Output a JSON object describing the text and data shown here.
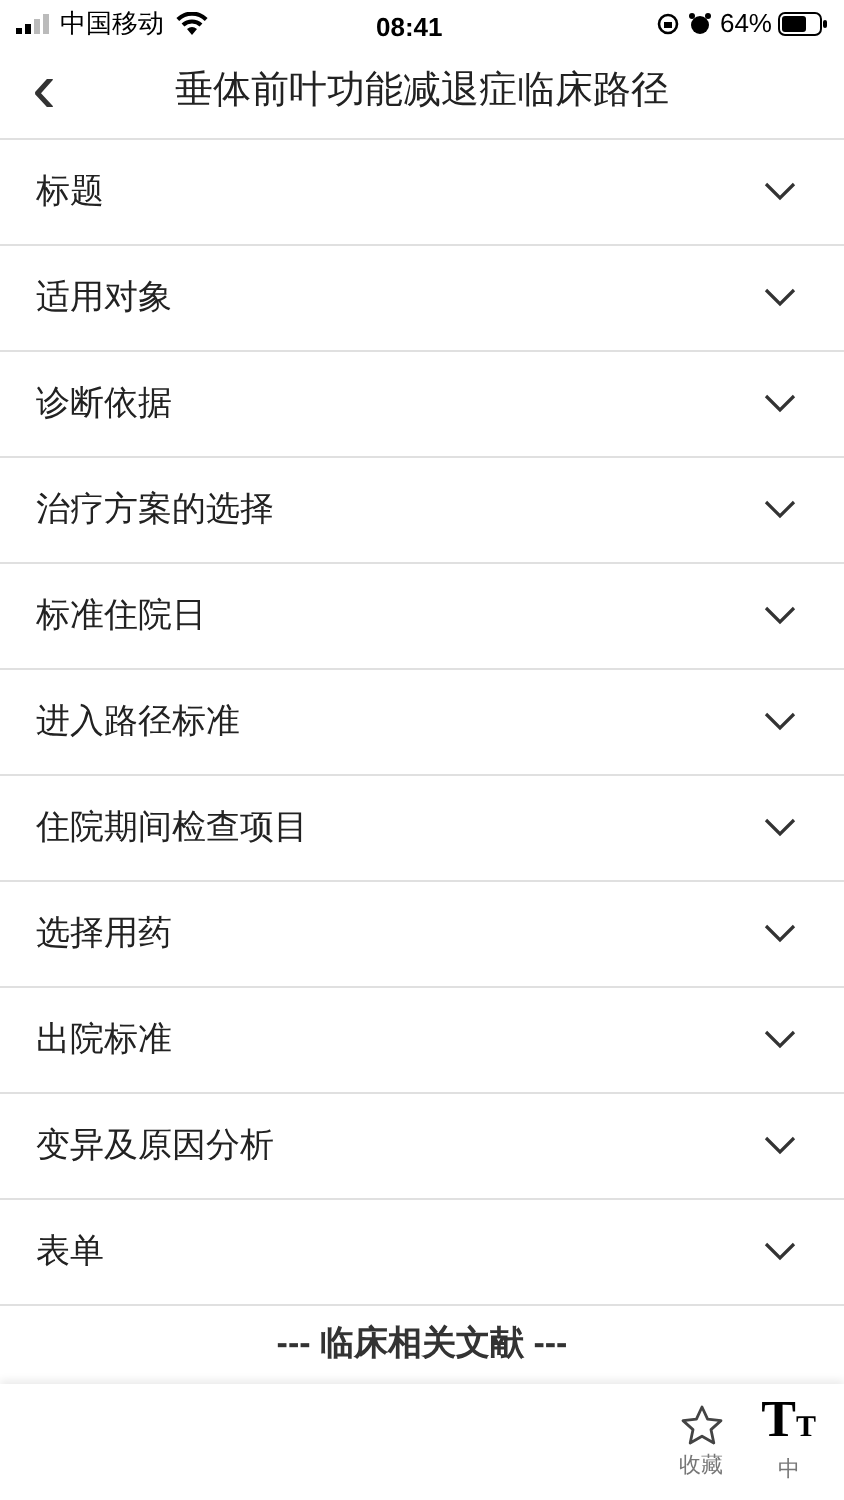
{
  "status_bar": {
    "carrier": "中国移动",
    "time": "08:41",
    "battery": "64%"
  },
  "nav": {
    "back": "‹",
    "title": "垂体前叶功能减退症临床路径"
  },
  "sections": [
    {
      "label": "标题",
      "expanded": false
    },
    {
      "label": "适用对象",
      "expanded": false
    },
    {
      "label": "诊断依据",
      "expanded": false
    },
    {
      "label": "治疗方案的选择",
      "expanded": false
    },
    {
      "label": "标准住院日",
      "expanded": false
    },
    {
      "label": "进入路径标准",
      "expanded": false
    },
    {
      "label": "住院期间检查项目",
      "expanded": false
    },
    {
      "label": "选择用药",
      "expanded": false
    },
    {
      "label": "出院标准",
      "expanded": false
    },
    {
      "label": "变异及原因分析",
      "expanded": false
    },
    {
      "label": "表单",
      "expanded": false
    }
  ],
  "references_heading": "---  临床相关文献  ---",
  "bottom_bar": {
    "favorite": {
      "label": "收藏",
      "selected": false
    },
    "font_size": {
      "big": "T",
      "small": "T",
      "label": "中"
    }
  }
}
